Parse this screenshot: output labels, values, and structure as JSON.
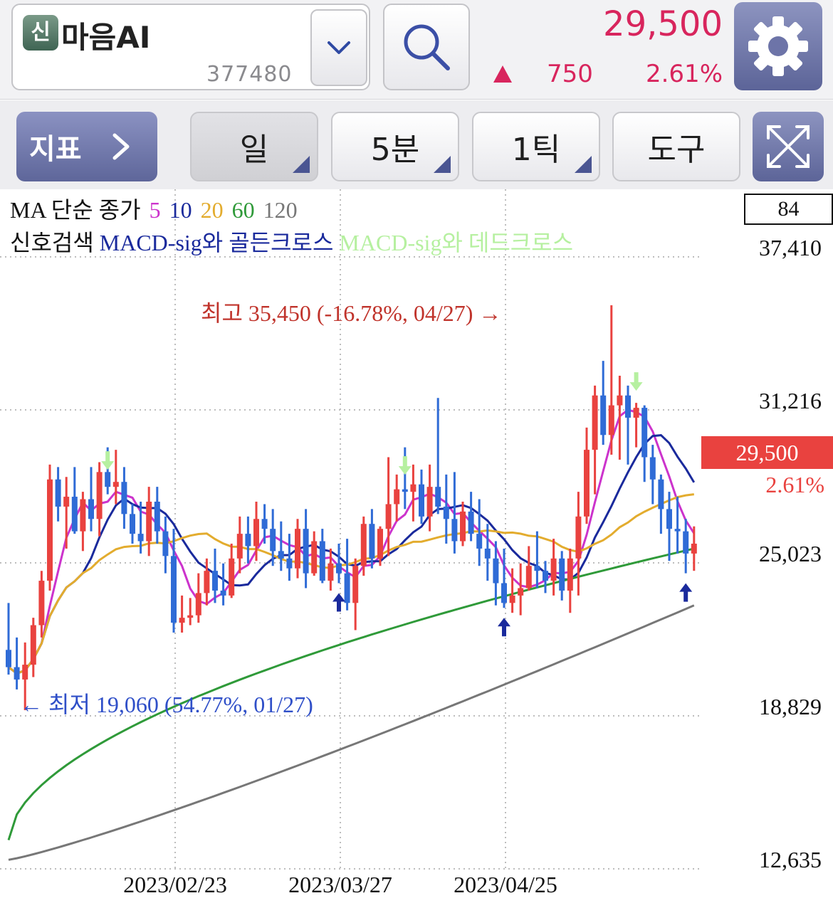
{
  "header": {
    "badge": "신",
    "stock_name": "마음AI",
    "stock_code": "377480",
    "price": "29,500",
    "change": "750",
    "change_pct": "2.61%",
    "up_color": "#d8255d",
    "icons": {
      "dropdown": "chevron-down-icon",
      "search": "search-icon",
      "settings": "gear-icon"
    }
  },
  "toolbar": {
    "indicator_label": "지표",
    "tabs": [
      {
        "label": "일",
        "active": true
      },
      {
        "label": "5분",
        "active": false
      },
      {
        "label": "1틱",
        "active": false
      },
      {
        "label": "도구",
        "active": false
      }
    ],
    "icons": {
      "indicator_arrow": "chevron-right-icon",
      "expand": "expand-icon"
    }
  },
  "legend": {
    "ma_prefix": "MA 단순 종가",
    "ma_periods": [
      {
        "label": "5",
        "color": "#cc33cc"
      },
      {
        "label": "10",
        "color": "#1a2a9c"
      },
      {
        "label": "20",
        "color": "#e3ac2e"
      },
      {
        "label": "60",
        "color": "#2f9a39"
      },
      {
        "label": "120",
        "color": "#777777"
      }
    ],
    "signal_prefix": "신호검색",
    "signal_golden": "MACD-sig와 골든크로스",
    "signal_golden_color": "#1a2a9c",
    "signal_dead": "MACD-sig와 데드크로스",
    "signal_dead_color": "#b6f0a0"
  },
  "count_box": "84",
  "current_price_tag": "29,500",
  "current_pct_tag": "2.61%",
  "chart_data": {
    "type": "candlestick",
    "y_ticks": [
      "37,410",
      "31,216",
      "25,023",
      "18,829",
      "12,635"
    ],
    "ylim": [
      12635,
      37410
    ],
    "x_ticks": [
      {
        "label": "2023/02/23",
        "index": 20
      },
      {
        "label": "2023/03/27",
        "index": 40
      },
      {
        "label": "2023/04/25",
        "index": 60
      }
    ],
    "max_annotation": "최고 35,450 (-16.78%, 04/27) →",
    "min_annotation": "← 최저 19,060 (54.77%, 01/27)",
    "up_color": "#e9423f",
    "down_color": "#2f6bd6",
    "candles": [
      [
        21500,
        23400,
        20500,
        20800
      ],
      [
        20800,
        22000,
        19900,
        20300
      ],
      [
        20300,
        21800,
        19060,
        20900
      ],
      [
        20900,
        22800,
        20400,
        22500
      ],
      [
        22500,
        24700,
        22000,
        24300
      ],
      [
        24300,
        29000,
        23900,
        28400
      ],
      [
        28400,
        28900,
        26700,
        27300
      ],
      [
        27300,
        28500,
        25600,
        27700
      ],
      [
        27700,
        28900,
        26200,
        26300
      ],
      [
        26300,
        27900,
        25500,
        27600
      ],
      [
        27600,
        28900,
        26300,
        26800
      ],
      [
        26800,
        29100,
        26100,
        28700
      ],
      [
        28700,
        29700,
        27800,
        28100
      ],
      [
        28100,
        29600,
        27400,
        28300
      ],
      [
        28300,
        28900,
        26400,
        27000
      ],
      [
        27000,
        27400,
        25800,
        26200
      ],
      [
        26200,
        27500,
        25400,
        25900
      ],
      [
        25900,
        28100,
        25300,
        27500
      ],
      [
        27500,
        28100,
        25800,
        26300
      ],
      [
        26300,
        26900,
        24600,
        25300
      ],
      [
        25300,
        26400,
        22200,
        22600
      ],
      [
        22600,
        23700,
        22200,
        22800
      ],
      [
        22800,
        23600,
        22500,
        22900
      ],
      [
        22900,
        24600,
        22600,
        23800
      ],
      [
        23800,
        25200,
        23300,
        24700
      ],
      [
        24700,
        25600,
        23400,
        23900
      ],
      [
        23900,
        25000,
        23300,
        23700
      ],
      [
        23700,
        25800,
        23600,
        25200
      ],
      [
        25200,
        26900,
        24600,
        26200
      ],
      [
        26200,
        26900,
        25000,
        25700
      ],
      [
        25700,
        27500,
        25100,
        26800
      ],
      [
        26800,
        27400,
        25800,
        26400
      ],
      [
        26400,
        27200,
        24900,
        25500
      ],
      [
        25500,
        26700,
        24700,
        25200
      ],
      [
        25200,
        26200,
        24300,
        24800
      ],
      [
        24800,
        26800,
        24400,
        26400
      ],
      [
        26400,
        27200,
        24000,
        24600
      ],
      [
        24600,
        26300,
        24500,
        25900
      ],
      [
        25900,
        26400,
        24200,
        24300
      ],
      [
        24300,
        25600,
        23900,
        25000
      ],
      [
        25000,
        25800,
        24200,
        24600
      ],
      [
        24600,
        26000,
        23100,
        23400
      ],
      [
        23400,
        25200,
        22300,
        24900
      ],
      [
        24900,
        26900,
        24500,
        26600
      ],
      [
        26600,
        27200,
        24800,
        25200
      ],
      [
        25200,
        26500,
        24900,
        26400
      ],
      [
        26400,
        29300,
        25300,
        27400
      ],
      [
        27400,
        28600,
        26700,
        28000
      ],
      [
        28000,
        29700,
        27200,
        27900
      ],
      [
        27900,
        29000,
        26700,
        28200
      ],
      [
        28200,
        28800,
        26600,
        26900
      ],
      [
        26900,
        29000,
        26300,
        28100
      ],
      [
        28100,
        31700,
        27000,
        27300
      ],
      [
        27300,
        28600,
        25800,
        26800
      ],
      [
        26800,
        28700,
        25400,
        25900
      ],
      [
        25900,
        27500,
        25700,
        27100
      ],
      [
        27100,
        27900,
        25900,
        26200
      ],
      [
        26200,
        27600,
        24900,
        25600
      ],
      [
        25600,
        26600,
        24300,
        25200
      ],
      [
        25200,
        25900,
        23300,
        24200
      ],
      [
        24200,
        25600,
        23200,
        23400
      ],
      [
        23400,
        24800,
        23000,
        23700
      ],
      [
        23700,
        25000,
        22900,
        24000
      ],
      [
        24000,
        25700,
        23900,
        24900
      ],
      [
        24900,
        26300,
        24000,
        24700
      ],
      [
        24700,
        25100,
        23800,
        24300
      ],
      [
        24300,
        26000,
        23700,
        25200
      ],
      [
        25200,
        25500,
        23500,
        23900
      ],
      [
        23900,
        25600,
        23000,
        25200
      ],
      [
        25200,
        27900,
        23700,
        26900
      ],
      [
        26900,
        30500,
        26600,
        29600
      ],
      [
        29600,
        32200,
        27800,
        31800
      ],
      [
        31800,
        33200,
        29800,
        30200
      ],
      [
        30200,
        35450,
        29400,
        31400
      ],
      [
        31400,
        32600,
        29200,
        31800
      ],
      [
        31800,
        32200,
        29000,
        30900
      ],
      [
        30900,
        31500,
        29700,
        31300
      ],
      [
        31300,
        31400,
        28300,
        29300
      ],
      [
        29300,
        29800,
        27400,
        28400
      ],
      [
        28400,
        28600,
        26200,
        27200
      ],
      [
        27200,
        27900,
        25100,
        26400
      ],
      [
        26400,
        27700,
        25400,
        26300
      ],
      [
        26300,
        26800,
        24600,
        25400
      ],
      [
        25400,
        26500,
        24700,
        25800
      ]
    ],
    "ma_series": [
      {
        "name": "5",
        "color": "#cc33cc"
      },
      {
        "name": "10",
        "color": "#1a2a9c"
      },
      {
        "name": "20",
        "color": "#e3ac2e"
      },
      {
        "name": "60",
        "color": "#2f9a39"
      },
      {
        "name": "120",
        "color": "#777777"
      }
    ],
    "golden_cross_indices": [
      40,
      60,
      82
    ],
    "dead_cross_indices": [
      12,
      48,
      76
    ]
  }
}
